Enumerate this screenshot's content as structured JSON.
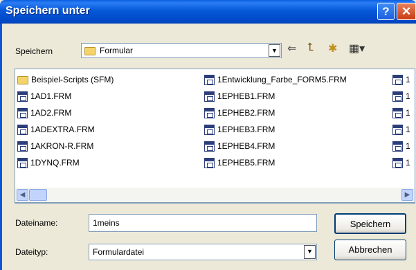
{
  "window": {
    "title": "Speichern unter",
    "help_label": "?",
    "close_label": "✕"
  },
  "location": {
    "label": "Speichern",
    "value": "Formular"
  },
  "files": {
    "col1": [
      "Beispiel-Scripts (SFM)",
      "1AD1.FRM",
      "1AD2.FRM",
      "1ADEXTRA.FRM",
      "1AKRON-R.FRM",
      "1DYNQ.FRM"
    ],
    "col2": [
      "1Entwicklung_Farbe_FORM5.FRM",
      "1EPHEB1.FRM",
      "1EPHEB2.FRM",
      "1EPHEB3.FRM",
      "1EPHEB4.FRM",
      "1EPHEB5.FRM"
    ],
    "col3": [
      "1",
      "1",
      "1",
      "1",
      "1",
      "1"
    ]
  },
  "filename": {
    "label": "Dateiname:",
    "value": "1meins"
  },
  "filetype": {
    "label": "Dateityp:",
    "value": "Formulardatei"
  },
  "buttons": {
    "save": "Speichern",
    "cancel": "Abbrechen"
  }
}
